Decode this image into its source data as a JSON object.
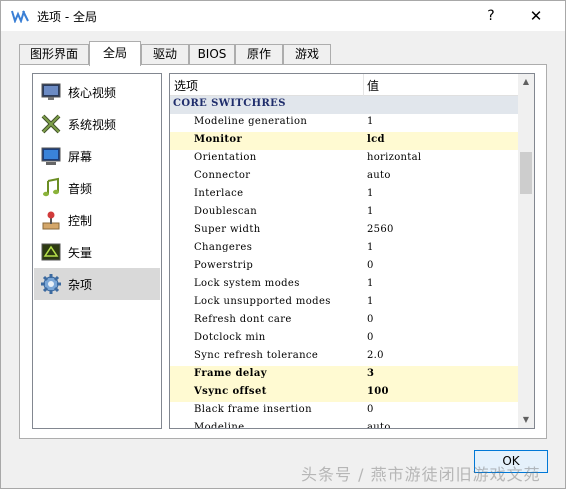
{
  "window": {
    "title": "选项 - 全局",
    "help": "?",
    "close": "✕"
  },
  "tabs": [
    {
      "label": "图形界面"
    },
    {
      "label": "全局",
      "active": true
    },
    {
      "label": "驱动"
    },
    {
      "label": "BIOS"
    },
    {
      "label": "原作"
    },
    {
      "label": "游戏"
    }
  ],
  "sidebar": {
    "items": [
      {
        "label": "核心视频",
        "icon": "monitor-icon"
      },
      {
        "label": "系统视频",
        "icon": "x-logo-icon"
      },
      {
        "label": "屏幕",
        "icon": "screen-icon"
      },
      {
        "label": "音频",
        "icon": "music-note-icon"
      },
      {
        "label": "控制",
        "icon": "joystick-icon"
      },
      {
        "label": "矢量",
        "icon": "vector-icon"
      },
      {
        "label": "杂项",
        "icon": "gear-icon",
        "selected": true
      }
    ]
  },
  "grid": {
    "col_key": "选项",
    "col_value": "值",
    "rows": [
      {
        "key": "CORE SWITCHRES",
        "value": "",
        "section": true
      },
      {
        "key": "Modeline generation",
        "value": "1"
      },
      {
        "key": "Monitor",
        "value": "lcd",
        "highlight": true
      },
      {
        "key": "Orientation",
        "value": "horizontal"
      },
      {
        "key": "Connector",
        "value": "auto"
      },
      {
        "key": "Interlace",
        "value": "1"
      },
      {
        "key": "Doublescan",
        "value": "1"
      },
      {
        "key": "Super width",
        "value": "2560"
      },
      {
        "key": "Changeres",
        "value": "1"
      },
      {
        "key": "Powerstrip",
        "value": "0"
      },
      {
        "key": "Lock system modes",
        "value": "1"
      },
      {
        "key": "Lock unsupported modes",
        "value": "1"
      },
      {
        "key": "Refresh dont care",
        "value": "0"
      },
      {
        "key": "Dotclock min",
        "value": "0"
      },
      {
        "key": "Sync refresh tolerance",
        "value": "2.0"
      },
      {
        "key": "Frame delay",
        "value": "3",
        "highlight": true
      },
      {
        "key": "Vsync offset",
        "value": "100",
        "highlight": true
      },
      {
        "key": "Black frame insertion",
        "value": "0"
      },
      {
        "key": "Modeline",
        "value": "auto"
      }
    ]
  },
  "footer": {
    "ok_label": "OK"
  },
  "watermark": "头条号 / 燕市游徒闭旧游戏文苑",
  "colors": {
    "section_bg": "#e1e6ec",
    "highlight_bg": "#fffad2",
    "selected_bg": "#d9d9d9",
    "ok_border": "#0078d7"
  }
}
